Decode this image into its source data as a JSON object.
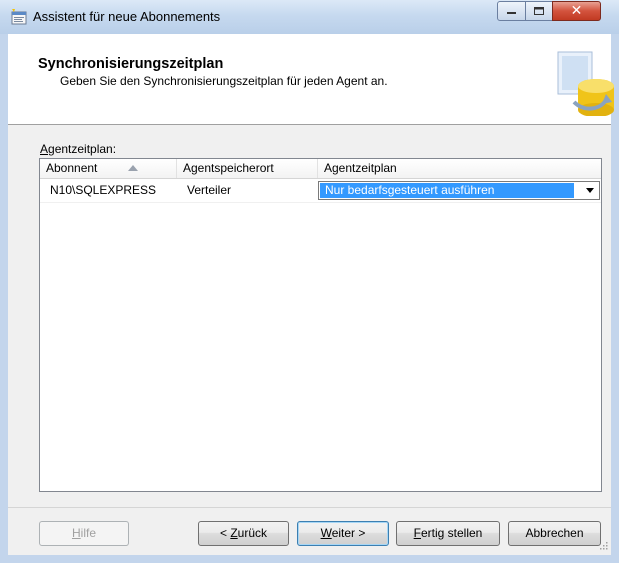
{
  "window": {
    "title": "Assistent für neue Abonnements",
    "icon": "wizard-icon",
    "controls": [
      "minimize-icon",
      "maximize-icon",
      "close-icon"
    ]
  },
  "banner": {
    "title": "Synchronisierungszeitplan",
    "subtitle": "Geben Sie den Synchronisierungszeitplan für jeden Agent an.",
    "art": "database-wizard-icon"
  },
  "agent_schedule": {
    "label_first": "A",
    "label_rest": "gentzeitplan:",
    "columns": [
      "Abonnent",
      "Agentspeicherort",
      "Agentzeitplan"
    ],
    "sort_indicator": "sort-ascending-icon",
    "rows": [
      {
        "subscriber": "N10\\SQLEXPRESS",
        "location": "Verteiler",
        "schedule": "Nur bedarfsgesteuert ausführen"
      }
    ]
  },
  "buttons": {
    "help": {
      "first": "H",
      "rest": "ilfe"
    },
    "back": {
      "pre": "< ",
      "first": "Z",
      "rest": "urück"
    },
    "next": {
      "first": "W",
      "rest": "eiter >"
    },
    "finish": {
      "first": "F",
      "rest": "ertig stellen"
    },
    "cancel": "Abbrechen"
  },
  "colors": {
    "selection": "#3399ff",
    "titlebar": "#c6d9ef",
    "close_button": "#c13a22"
  }
}
